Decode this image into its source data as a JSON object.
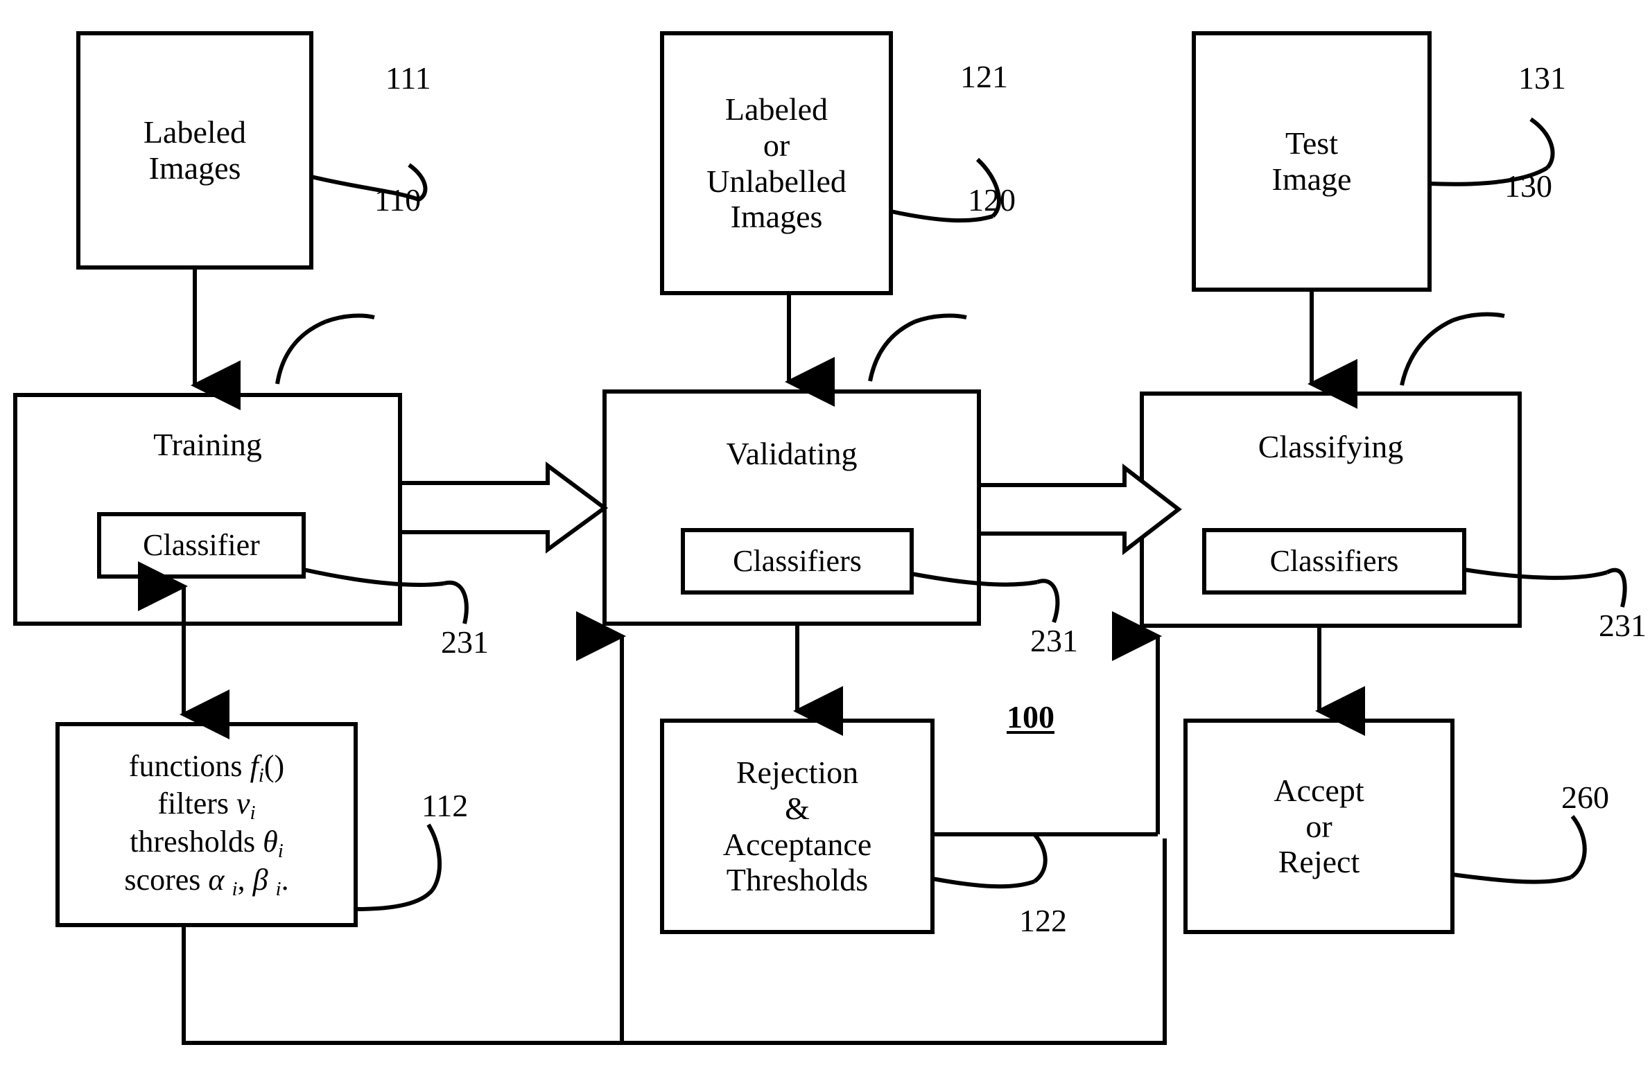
{
  "figure": {
    "title_ref": "100",
    "background_color": "#ffffff",
    "ink_color": "#000000"
  },
  "boxes": {
    "labeled_images": {
      "lines": [
        "Labeled",
        "Images"
      ],
      "ref": "111"
    },
    "labeled_or_unlabelled_images": {
      "lines": [
        "Labeled",
        "or",
        "Unlabelled",
        "Images"
      ],
      "ref": "121"
    },
    "test_image": {
      "lines": [
        "Test",
        "Image"
      ],
      "ref": "131"
    },
    "training": {
      "label": "Training",
      "ref": "110",
      "inner_label": "Classifier",
      "inner_ref": "231"
    },
    "validating": {
      "label": "Validating",
      "ref": "120",
      "inner_label": "Classifiers",
      "inner_ref": "231"
    },
    "classifying": {
      "label": "Classifying",
      "ref": "130",
      "inner_label": "Classifiers",
      "inner_ref": "231"
    },
    "parameters": {
      "ref": "112",
      "lines": [
        {
          "prefix": "functions ",
          "sym": "f",
          "sub": "i",
          "suffix": "()"
        },
        {
          "prefix": "filters ",
          "sym": "v",
          "sub": "i",
          "suffix": ""
        },
        {
          "prefix": "thresholds ",
          "sym": "θ",
          "sub": "i",
          "suffix": ""
        },
        {
          "prefix": "scores ",
          "sym": "α",
          "sub": "i",
          "suffix": ", β i."
        }
      ],
      "plain_lines": [
        "functions f i()",
        "filters v i",
        "thresholds θ i",
        "scores α i, β i."
      ]
    },
    "thresholds": {
      "lines": [
        "Rejection",
        "&",
        "Acceptance",
        "Thresholds"
      ],
      "ref": "122"
    },
    "accept_or_reject": {
      "lines": [
        "Accept",
        "or",
        "Reject"
      ],
      "ref": "260"
    }
  },
  "refs": {
    "r111": "111",
    "r121": "121",
    "r131": "131",
    "r110": "110",
    "r120": "120",
    "r130": "130",
    "r112": "112",
    "r122": "122",
    "r260": "260",
    "r100": "100",
    "r231_left": "231",
    "r231_mid": "231",
    "r231_right": "231"
  }
}
